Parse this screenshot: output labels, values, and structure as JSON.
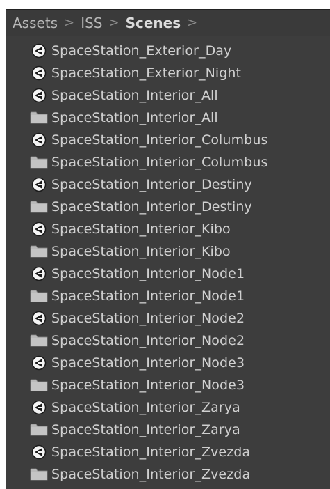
{
  "breadcrumb": {
    "items": [
      "Assets",
      "ISS",
      "Scenes"
    ]
  },
  "files": [
    {
      "name": "SpaceStation_Exterior_Day",
      "type": "scene-icon"
    },
    {
      "name": "SpaceStation_Exterior_Night",
      "type": "scene-icon"
    },
    {
      "name": "SpaceStation_Interior_All",
      "type": "scene-icon"
    },
    {
      "name": "SpaceStation_Interior_All",
      "type": "folder-icon"
    },
    {
      "name": "SpaceStation_Interior_Columbus",
      "type": "scene-icon"
    },
    {
      "name": "SpaceStation_Interior_Columbus",
      "type": "folder-icon"
    },
    {
      "name": "SpaceStation_Interior_Destiny",
      "type": "scene-icon"
    },
    {
      "name": "SpaceStation_Interior_Destiny",
      "type": "folder-icon"
    },
    {
      "name": "SpaceStation_Interior_Kibo",
      "type": "scene-icon"
    },
    {
      "name": "SpaceStation_Interior_Kibo",
      "type": "folder-icon"
    },
    {
      "name": "SpaceStation_Interior_Node1",
      "type": "scene-icon"
    },
    {
      "name": "SpaceStation_Interior_Node1",
      "type": "folder-icon"
    },
    {
      "name": "SpaceStation_Interior_Node2",
      "type": "scene-icon"
    },
    {
      "name": "SpaceStation_Interior_Node2",
      "type": "folder-icon"
    },
    {
      "name": "SpaceStation_Interior_Node3",
      "type": "scene-icon"
    },
    {
      "name": "SpaceStation_Interior_Node3",
      "type": "folder-icon"
    },
    {
      "name": "SpaceStation_Interior_Zarya",
      "type": "scene-icon"
    },
    {
      "name": "SpaceStation_Interior_Zarya",
      "type": "folder-icon"
    },
    {
      "name": "SpaceStation_Interior_Zvezda",
      "type": "scene-icon"
    },
    {
      "name": "SpaceStation_Interior_Zvezda",
      "type": "folder-icon"
    }
  ],
  "colors": {
    "panel_background": "#3d3d3d",
    "text": "#d0d0d0",
    "folder": "#b9b9b9"
  }
}
